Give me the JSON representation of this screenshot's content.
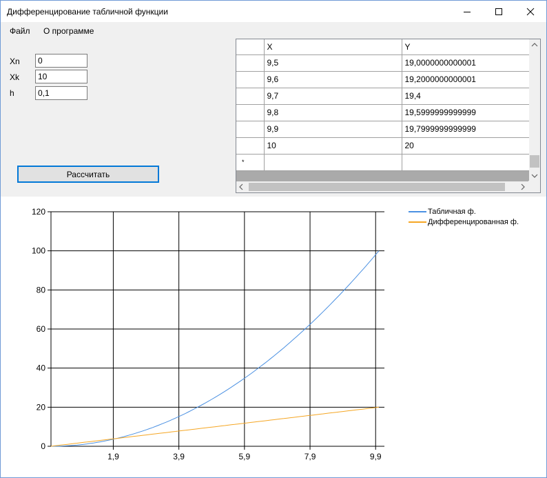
{
  "window": {
    "title": "Дифференцирование табличной функции"
  },
  "menu": {
    "items": [
      {
        "label": "Файл"
      },
      {
        "label": "О программе"
      }
    ]
  },
  "inputs": {
    "xn": {
      "label": "Xn",
      "value": "0"
    },
    "xk": {
      "label": "Xk",
      "value": "10"
    },
    "h": {
      "label": "h",
      "value": "0,1"
    }
  },
  "calc_button": {
    "label": "Рассчитать"
  },
  "grid": {
    "columns": [
      "X",
      "Y"
    ],
    "rows": [
      [
        "9,5",
        "19,0000000000001"
      ],
      [
        "9,6",
        "19,2000000000001"
      ],
      [
        "9,7",
        "19,4"
      ],
      [
        "9,8",
        "19,5999999999999"
      ],
      [
        "9,9",
        "19,7999999999999"
      ],
      [
        "10",
        "20"
      ]
    ],
    "new_row_marker": "*"
  },
  "colors": {
    "tabular": "#4a90e2",
    "differentiated": "#f5a623",
    "accent": "#0078d7"
  },
  "chart_data": {
    "type": "line",
    "ylim": [
      0,
      120
    ],
    "xlim": [
      0,
      10
    ],
    "y_ticks": [
      "120",
      "100",
      "80",
      "60",
      "40",
      "20",
      "0"
    ],
    "x_ticks": [
      "1,9",
      "3,9",
      "5,9",
      "7,9",
      "9,9"
    ],
    "x_tick_values": [
      1.9,
      3.9,
      5.9,
      7.9,
      9.9
    ],
    "grid": true,
    "legend": "top-right",
    "series": [
      {
        "name": "Табличная ф.",
        "function": "x^2",
        "x_start": 0,
        "x_end": 10,
        "step": 0.1
      },
      {
        "name": "Дифференцированная ф.",
        "function": "2x",
        "x_start": 0,
        "x_end": 10,
        "step": 0.1
      }
    ]
  }
}
